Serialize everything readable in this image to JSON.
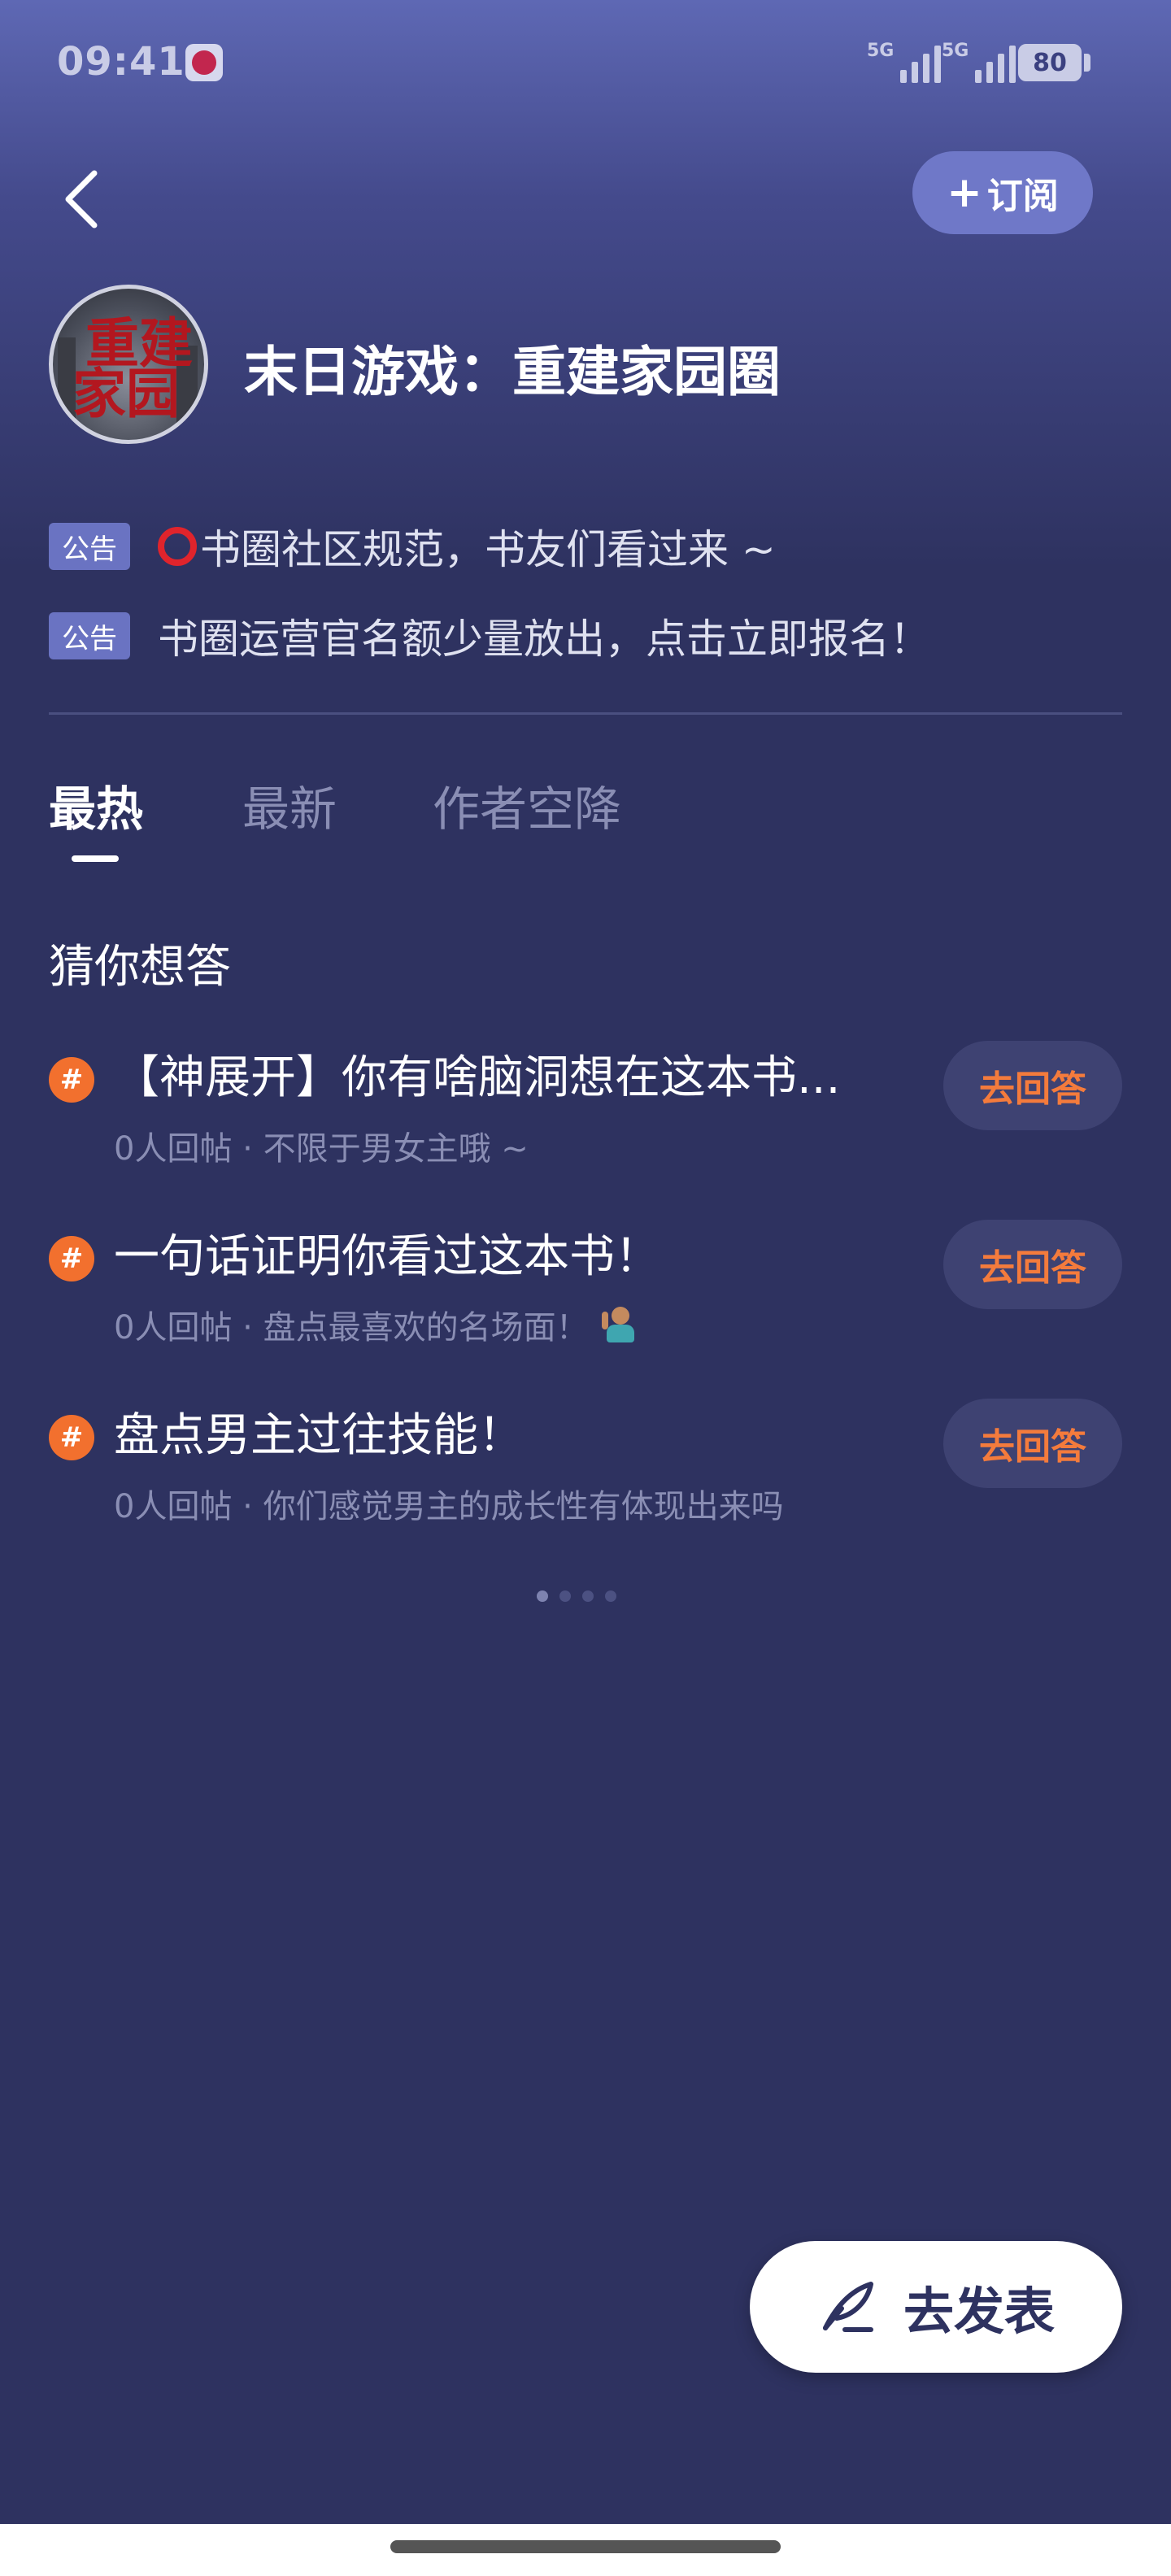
{
  "status_bar": {
    "time": "09:41",
    "app_icon": "metro-app-icon",
    "signal1_label": "5G",
    "signal2_label": "5G",
    "battery": "80"
  },
  "header": {
    "back_icon": "chevron-left-icon",
    "subscribe_label": "订阅",
    "subscribe_icon": "plus-icon"
  },
  "circle": {
    "avatar_text_line1": "重建",
    "avatar_text_line2": "家园",
    "title": "末日游戏：重建家园圈"
  },
  "notices": [
    {
      "tag": "公告",
      "text": "书圈社区规范，书友们看过来 ~",
      "icon": "red-circle-icon"
    },
    {
      "tag": "公告",
      "text": "书圈运营官名额少量放出，点击立即报名！"
    }
  ],
  "tabs": [
    {
      "label": "最热",
      "active": true
    },
    {
      "label": "最新",
      "active": false
    },
    {
      "label": "作者空降",
      "active": false
    }
  ],
  "section_title": "猜你想答",
  "topics": [
    {
      "hash": "#",
      "title": "【神展开】你有啥脑洞想在这本书...",
      "subtitle": "0人回帖 · 不限于男女主哦 ~",
      "button": "去回答"
    },
    {
      "hash": "#",
      "title": "一句话证明你看过这本书！",
      "subtitle": "0人回帖 · 盘点最喜欢的名场面！",
      "subtitle_icon": "person-raising-hand-icon",
      "button": "去回答"
    },
    {
      "hash": "#",
      "title": "盘点男主过往技能！",
      "subtitle": "0人回帖 · 你们感觉男主的成长性有体现出来吗",
      "button": "去回答"
    }
  ],
  "pager": {
    "count": 4,
    "active_index": 0
  },
  "post_button": {
    "label": "去发表",
    "icon": "quill-pen-icon"
  },
  "colors": {
    "background": "#2e3260",
    "accent_orange": "#f47b3c",
    "tag_bg": "#6a73c2",
    "subscribe_bg": "#6f78c8"
  }
}
